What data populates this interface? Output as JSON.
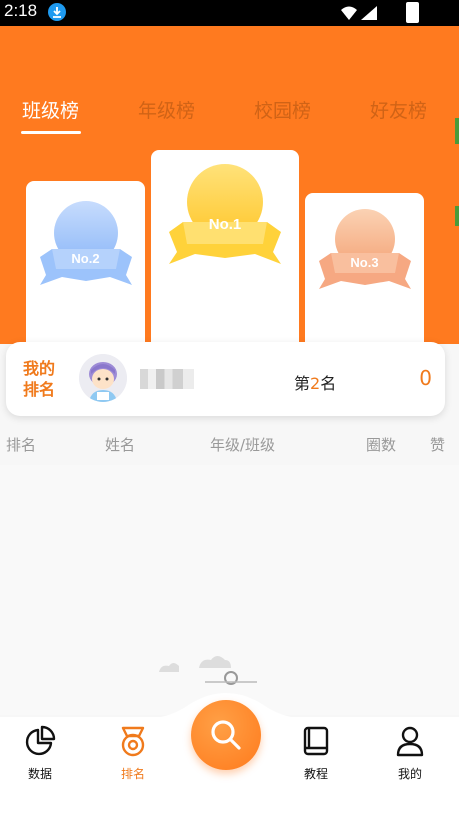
{
  "status_bar": {
    "time": "2:18"
  },
  "tabs": [
    {
      "label": "班级榜"
    },
    {
      "label": "年级榜"
    },
    {
      "label": "校园榜"
    },
    {
      "label": "好友榜"
    }
  ],
  "podium": {
    "first": "No.1",
    "second": "No.2",
    "third": "No.3"
  },
  "my_rank": {
    "label_line1": "我的",
    "label_line2": "排名",
    "rank_prefix": "第",
    "rank_number": "2",
    "rank_suffix": "名",
    "points": "0"
  },
  "table_headers": [
    "排名",
    "姓名",
    "年级/班级",
    "圈数",
    "赞"
  ],
  "bottom_nav": [
    {
      "label": "数据",
      "icon": "pie-chart-icon"
    },
    {
      "label": "排名",
      "icon": "medal-icon"
    },
    {
      "label": "",
      "icon": "search-icon"
    },
    {
      "label": "教程",
      "icon": "book-icon"
    },
    {
      "label": "我的",
      "icon": "user-icon"
    }
  ],
  "colors": {
    "accent": "#ff7a1f",
    "gold": "#ffd84a",
    "silver_blue": "#9cc3fb",
    "bronze": "#f6a882"
  }
}
